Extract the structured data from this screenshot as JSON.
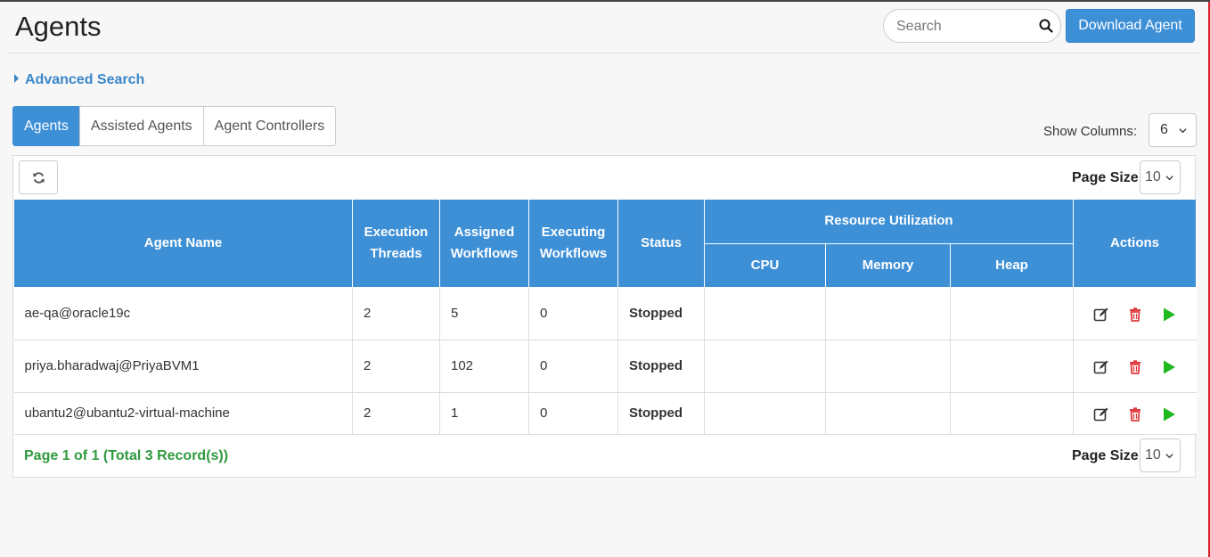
{
  "header": {
    "title": "Agents",
    "search_placeholder": "Search",
    "download_label": "Download Agent"
  },
  "advanced_search_label": "Advanced Search",
  "tabs": [
    {
      "label": "Agents",
      "active": true
    },
    {
      "label": "Assisted Agents",
      "active": false
    },
    {
      "label": "Agent Controllers",
      "active": false
    }
  ],
  "show_columns": {
    "label": "Show Columns:",
    "value": "6"
  },
  "page_size": {
    "label": "Page Size",
    "value": "10"
  },
  "table": {
    "headers": {
      "agent_name": "Agent Name",
      "execution_threads": "Execution Threads",
      "assigned_workflows": "Assigned Workflows",
      "executing_workflows": "Executing Workflows",
      "status": "Status",
      "resource_utilization": "Resource Utilization",
      "cpu": "CPU",
      "memory": "Memory",
      "heap": "Heap",
      "actions": "Actions"
    },
    "rows": [
      {
        "agent_name": "ae-qa@oracle19c",
        "execution_threads": "2",
        "assigned_workflows": "5",
        "executing_workflows": "0",
        "status": "Stopped",
        "cpu": "",
        "memory": "",
        "heap": ""
      },
      {
        "agent_name": "priya.bharadwaj@PriyaBVM1",
        "execution_threads": "2",
        "assigned_workflows": "102",
        "executing_workflows": "0",
        "status": "Stopped",
        "cpu": "",
        "memory": "",
        "heap": ""
      },
      {
        "agent_name": "ubantu2@ubantu2-virtual-machine",
        "execution_threads": "2",
        "assigned_workflows": "1",
        "executing_workflows": "0",
        "status": "Stopped",
        "cpu": "",
        "memory": "",
        "heap": ""
      }
    ]
  },
  "footer": {
    "summary": "Page 1 of 1 (Total 3 Record(s))"
  },
  "colors": {
    "accent": "#3d8fd6",
    "status_stopped": "#d13438",
    "summary_green": "#2f9a3e",
    "play_green": "#1fb81f"
  },
  "icons": [
    "search-icon",
    "refresh-icon",
    "edit-icon",
    "trash-icon",
    "play-icon",
    "chevron-down-icon",
    "caret-right-icon"
  ]
}
